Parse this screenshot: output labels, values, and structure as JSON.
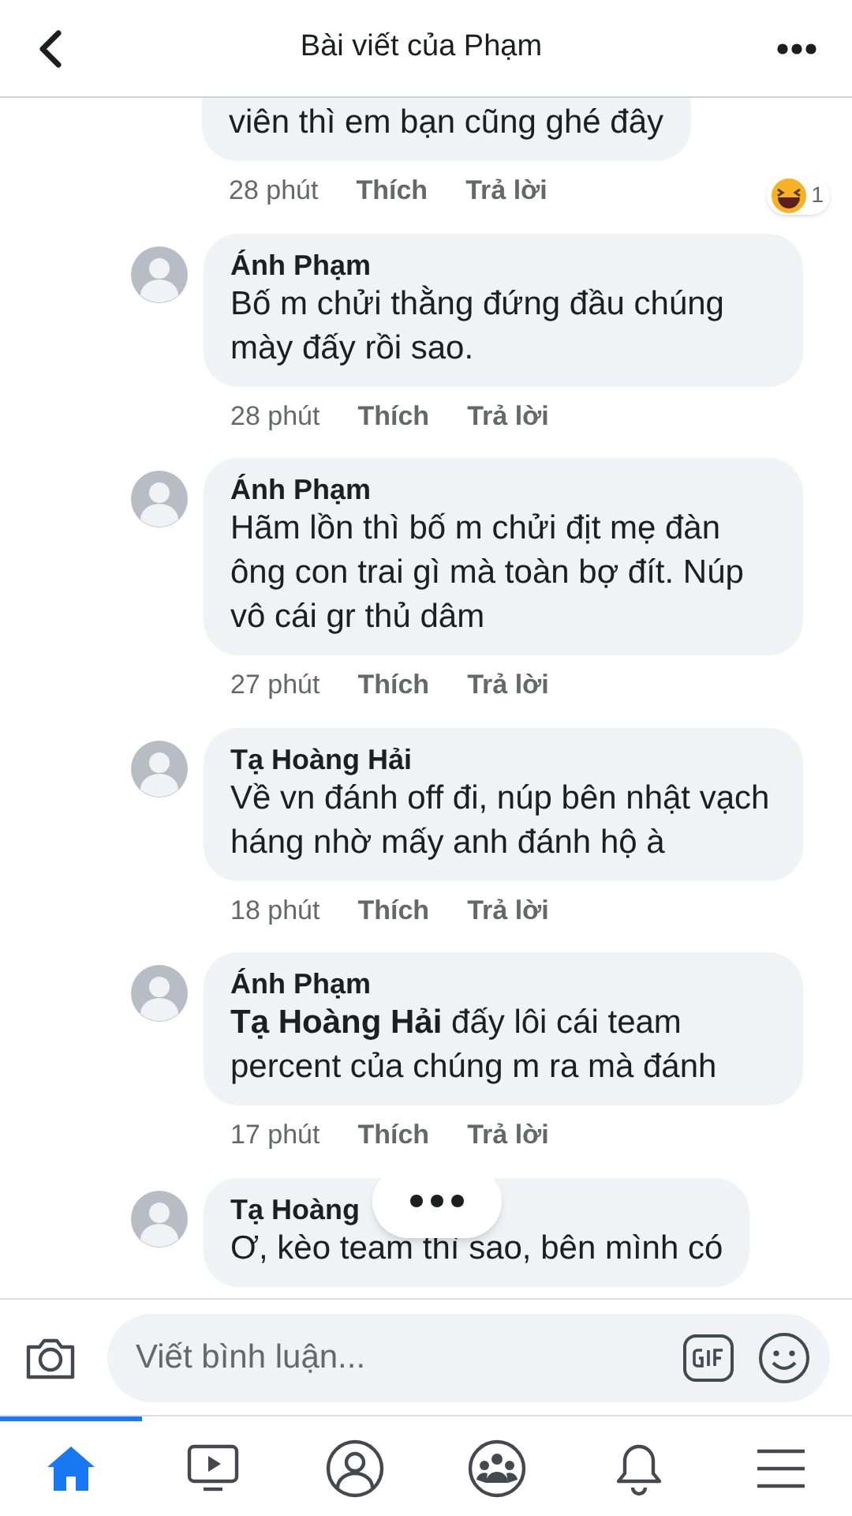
{
  "header": {
    "title": "Bài viết của Phạm"
  },
  "comments": [
    {
      "kind": "partial",
      "text": "viên thì em bạn cũng ghé đây",
      "time": "28 phút",
      "like": "Thích",
      "reply": "Trả lời",
      "reaction_count": "1"
    },
    {
      "kind": "full",
      "author": "Ánh Phạm",
      "text": "Bố m chửi thằng đứng đầu chúng mày đấy rồi sao.",
      "time": "28 phút",
      "like": "Thích",
      "reply": "Trả lời"
    },
    {
      "kind": "full",
      "author": "Ánh Phạm",
      "text": "Hãm lồn thì bố m chửi địt mẹ đàn ông con trai gì mà toàn bợ đít. Núp vô cái gr thủ dâm",
      "time": "27 phút",
      "like": "Thích",
      "reply": "Trả lời"
    },
    {
      "kind": "full",
      "author": "Tạ Hoàng Hải",
      "text": "Về vn đánh off đi, núp bên nhật vạch háng nhờ mấy anh đánh hộ à",
      "time": "18 phút",
      "like": "Thích",
      "reply": "Trả lời"
    },
    {
      "kind": "full",
      "author": "Ánh Phạm",
      "text": "**Tạ Hoàng Hải** đấy lôi cái team percent của chúng m ra mà đánh",
      "time": "17 phút",
      "like": "Thích",
      "reply": "Trả lời"
    },
    {
      "kind": "cut",
      "author": "Tạ Hoàng",
      "text": "Ơ, kèo team thì sao, bên mình có"
    }
  ],
  "composer": {
    "placeholder": "Viết bình luận..."
  },
  "nav": [
    {
      "kind": "home",
      "selected": true
    },
    {
      "kind": "video",
      "selected": false
    },
    {
      "kind": "profile",
      "selected": false
    },
    {
      "kind": "groups",
      "selected": false
    },
    {
      "kind": "bell",
      "selected": false
    },
    {
      "kind": "menu",
      "selected": false
    }
  ]
}
